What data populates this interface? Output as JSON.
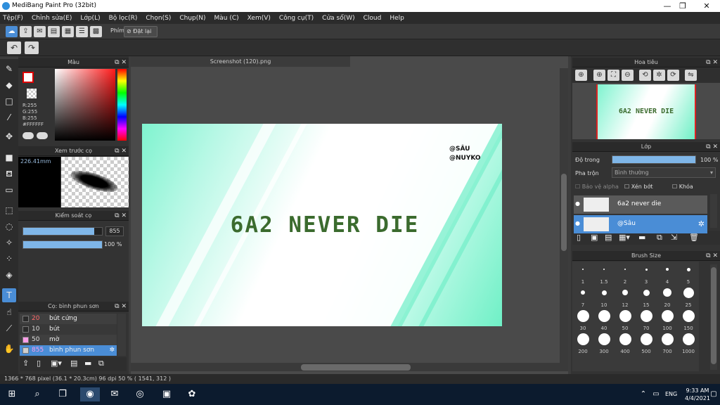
{
  "window": {
    "title": "MediBang Paint Pro (32bit)",
    "minimize": "—",
    "maximize": "❐",
    "close": "✕"
  },
  "menu": [
    "Tệp(F)",
    "Chỉnh sửa(E)",
    "Lớp(L)",
    "Bộ lọc(R)",
    "Chọn(S)",
    "Chụp(N)",
    "Màu (C)",
    "Xem(V)",
    "Công cụ(T)",
    "Cửa sổ(W)",
    "Cloud",
    "Help"
  ],
  "toolbar": {
    "shortcut_label": "Phím",
    "reset_label": "Đặt lại"
  },
  "color_panel": {
    "title": "Màu",
    "r": "R:255",
    "g": "G:255",
    "b": "B:255",
    "hex": "#FFFFFF"
  },
  "brush_preview": {
    "title": "Xem trước cọ",
    "size": "226.41mm"
  },
  "brush_control": {
    "title": "Kiểm soát cọ",
    "size_value": "855",
    "opacity_value": "100 %",
    "size_fraction": 0.9,
    "opacity_fraction": 1.0
  },
  "brush_list": {
    "title": "Cọ: bình phun sơn",
    "items": [
      {
        "size": "20",
        "name": "bút cứng",
        "size_color": "#ff6a6a",
        "swatch": "#2a2a2a",
        "selected": false
      },
      {
        "size": "10",
        "name": "bút",
        "size_color": "#dddddd",
        "swatch": "#2a2a2a",
        "selected": false
      },
      {
        "size": "50",
        "name": "mờ",
        "size_color": "#dddddd",
        "swatch": "#ff9ee8",
        "selected": false
      },
      {
        "size": "855",
        "name": "bình phun sơn",
        "size_color": "#ff9ee8",
        "swatch": "#cfcfcf",
        "selected": true
      }
    ]
  },
  "document": {
    "tab_title": "Screenshot (120).png",
    "headline": "6A2 NEVER DIE",
    "handle1": "@SÂU",
    "handle2": "@NUYKO"
  },
  "navigator": {
    "title": "Hoa tiêu",
    "preview_text": "6A2 NEVER DIE"
  },
  "layers_panel": {
    "title": "Lớp",
    "opacity_label": "Độ trong",
    "opacity_value": "100 %",
    "blend_label": "Pha trộn",
    "blend_value": "Bình thường",
    "protect_alpha": "Bảo vệ alpha",
    "clipping": "Xén bớt",
    "lock": "Khóa",
    "layers": [
      {
        "name": "6a2 never die",
        "selected": false
      },
      {
        "name": "@Sâu",
        "selected": true
      }
    ]
  },
  "brush_size_panel": {
    "title": "Brush Size",
    "sizes": [
      "1",
      "1.5",
      "2",
      "3",
      "4",
      "5",
      "7",
      "10",
      "12",
      "15",
      "20",
      "25",
      "30",
      "40",
      "50",
      "70",
      "100",
      "150",
      "200",
      "300",
      "400",
      "500",
      "700",
      "1000"
    ]
  },
  "status": {
    "text": "1366 * 768 pixel   (36.1 * 20.3cm)   96 dpi   50 %   ( 1541, 312 )"
  },
  "taskbar": {
    "lang": "ENG",
    "time": "9:33 AM",
    "date": "4/4/2021"
  }
}
